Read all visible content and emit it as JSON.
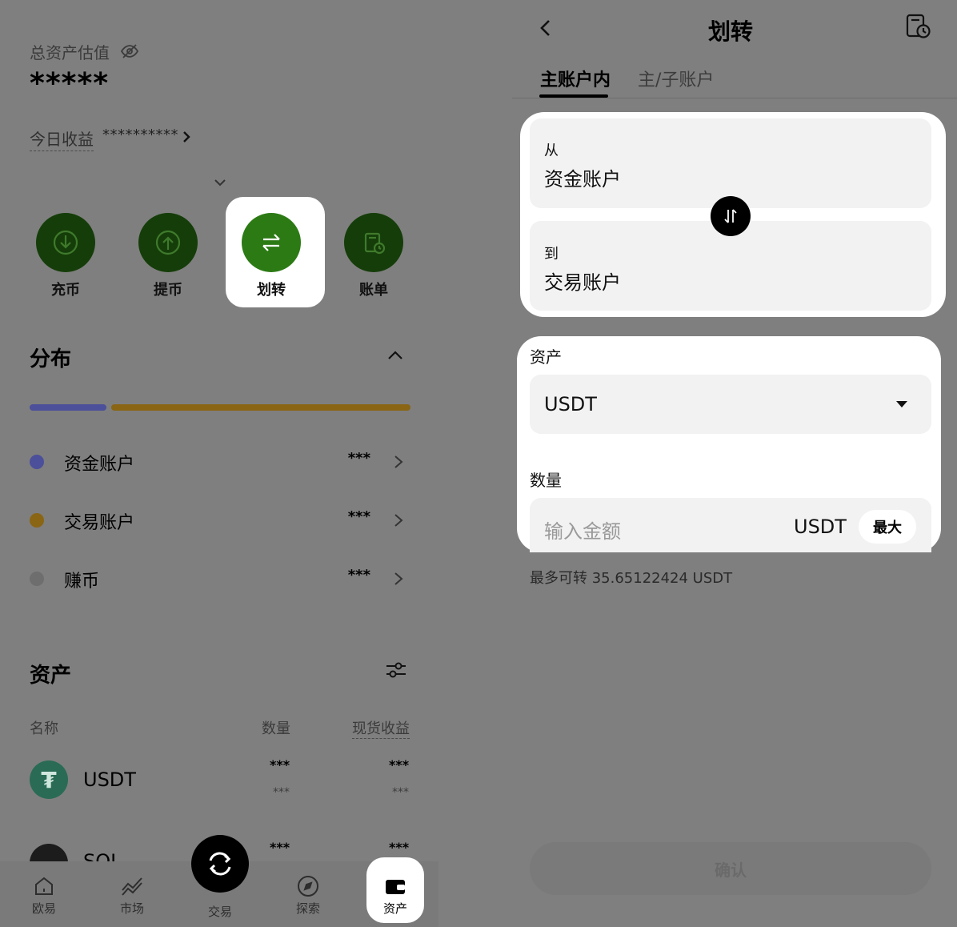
{
  "left": {
    "total_label": "总资产估值",
    "masked_balance": "*****",
    "today_label": "今日收益",
    "today_value": "**********",
    "actions": [
      {
        "label": "充币",
        "icon": "deposit-icon"
      },
      {
        "label": "提币",
        "icon": "withdraw-icon"
      },
      {
        "label": "划转",
        "icon": "transfer-icon",
        "highlighted": true
      },
      {
        "label": "账单",
        "icon": "bill-icon"
      }
    ],
    "distribution": {
      "title": "分布",
      "accounts": [
        {
          "name": "资金账户",
          "value": "***",
          "color": "#4c4f9a"
        },
        {
          "name": "交易账户",
          "value": "***",
          "color": "#8a6514"
        },
        {
          "name": "赚币",
          "value": "***",
          "color": "#6e6e6e"
        }
      ]
    },
    "assets": {
      "title": "资产",
      "columns": {
        "name": "名称",
        "qty": "数量",
        "pnl": "现货收益"
      },
      "rows": [
        {
          "name": "USDT",
          "icon": "tether-icon",
          "qty": "***",
          "qty_sub": "***",
          "pnl": "***",
          "pnl_sub": "***"
        },
        {
          "name": "SOL",
          "icon": "solana-icon",
          "qty": "***",
          "pnl": "***"
        }
      ]
    },
    "nav": [
      {
        "label": "欧易",
        "icon": "home-icon"
      },
      {
        "label": "市场",
        "icon": "market-icon"
      },
      {
        "label": "交易",
        "icon": "trade-icon"
      },
      {
        "label": "探索",
        "icon": "explore-icon"
      },
      {
        "label": "资产",
        "icon": "wallet-icon",
        "active": true
      }
    ]
  },
  "right": {
    "title": "划转",
    "tabs": [
      {
        "label": "主账户内",
        "active": true
      },
      {
        "label": "主/子账户",
        "active": false
      }
    ],
    "from": {
      "label": "从",
      "value": "资金账户"
    },
    "to": {
      "label": "到",
      "value": "交易账户"
    },
    "asset": {
      "label": "资产",
      "selected": "USDT"
    },
    "amount": {
      "label": "数量",
      "placeholder": "输入金额",
      "unit": "USDT",
      "max_label": "最大"
    },
    "available": "最多可转 35.65122424 USDT",
    "confirm_label": "确认"
  },
  "colors": {
    "overlay_gray": "#7f7f7f",
    "action_green": "#153d09",
    "action_green_highlight": "#2c7a14",
    "funding_blue": "#4c4f9a",
    "trading_gold": "#8a6514"
  }
}
